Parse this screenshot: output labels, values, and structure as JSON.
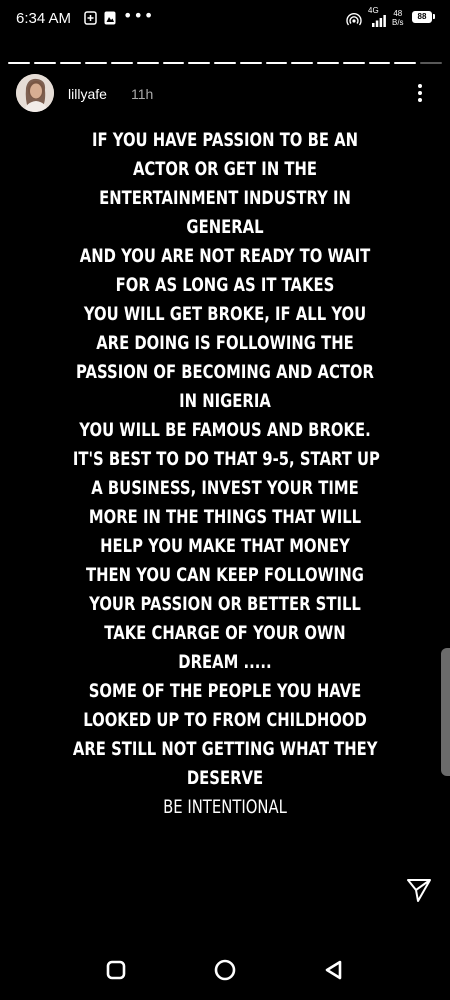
{
  "status_bar": {
    "time": "6:34 AM",
    "dots": "•••",
    "network": "4G",
    "speed_value": "48",
    "speed_unit": "B/s",
    "battery": "88"
  },
  "story": {
    "progress_total": 17,
    "progress_done": 16,
    "username": "lillyafe",
    "time_ago": "11h",
    "lines": [
      "IF YOU HAVE PASSION TO BE AN",
      "ACTOR OR GET IN THE",
      "ENTERTAINMENT INDUSTRY IN",
      "GENERAL",
      "AND YOU ARE NOT READY TO WAIT",
      "FOR AS LONG AS IT TAKES",
      "YOU WILL GET BROKE, IF ALL YOU",
      "ARE DOING IS FOLLOWING THE",
      "PASSION OF BECOMING AND ACTOR",
      "IN NIGERIA",
      "YOU WILL BE FAMOUS AND BROKE.",
      "IT'S BEST TO DO THAT 9-5, START UP",
      "A BUSINESS, INVEST YOUR TIME",
      "MORE IN THE THINGS THAT WILL",
      "HELP YOU MAKE THAT MONEY",
      "THEN YOU CAN KEEP FOLLOWING",
      "YOUR PASSION OR BETTER STILL",
      "TAKE CHARGE OF YOUR OWN",
      "DREAM .....",
      "SOME OF THE PEOPLE YOU HAVE",
      "LOOKED UP TO FROM CHILDHOOD",
      "ARE STILL NOT GETTING WHAT THEY",
      "DESERVE",
      "BE INTENTIONAL"
    ]
  },
  "icons": {
    "more": "more-vertical-icon",
    "send": "send-icon",
    "nav_recents": "recents-icon",
    "nav_home": "home-icon",
    "nav_back": "back-icon"
  },
  "colors": {
    "background": "#000000",
    "text": "#ffffff",
    "timestamp": "#aaaaaa",
    "progress_inactive": "#595959"
  }
}
